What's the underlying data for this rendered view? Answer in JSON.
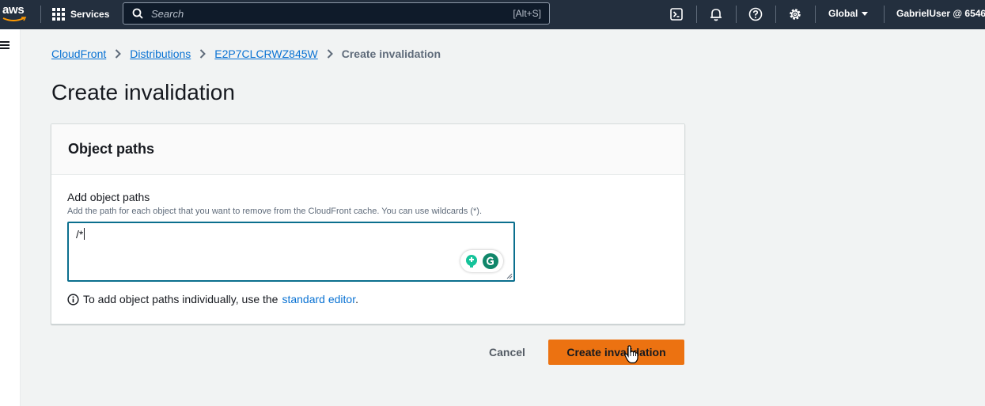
{
  "topnav": {
    "logo_text": "aws",
    "services_label": "Services",
    "search_placeholder": "Search",
    "search_shortcut": "[Alt+S]",
    "region_label": "Global",
    "account_label": "GabrielUser @ 6546",
    "icons": [
      "cloudshell-icon",
      "notifications-icon",
      "help-icon",
      "settings-icon"
    ]
  },
  "breadcrumb": {
    "items": [
      "CloudFront",
      "Distributions",
      "E2P7CLCRWZ845W"
    ],
    "current": "Create invalidation"
  },
  "page": {
    "title": "Create invalidation"
  },
  "object_paths": {
    "header": "Object paths",
    "field_label": "Add object paths",
    "field_description": "Add the path for each object that you want to remove from the CloudFront cache. You can use wildcards (*).",
    "textarea_value": "/*",
    "help_prefix": "To add object paths individually, use the",
    "help_link": "standard editor",
    "help_suffix": "."
  },
  "actions": {
    "cancel_label": "Cancel",
    "submit_label": "Create invalidation"
  },
  "colors": {
    "nav_bg": "#232f3e",
    "primary": "#ec7211",
    "link": "#0972d3",
    "focus": "#0b6f8e",
    "grammar_green": "#15c39a"
  }
}
